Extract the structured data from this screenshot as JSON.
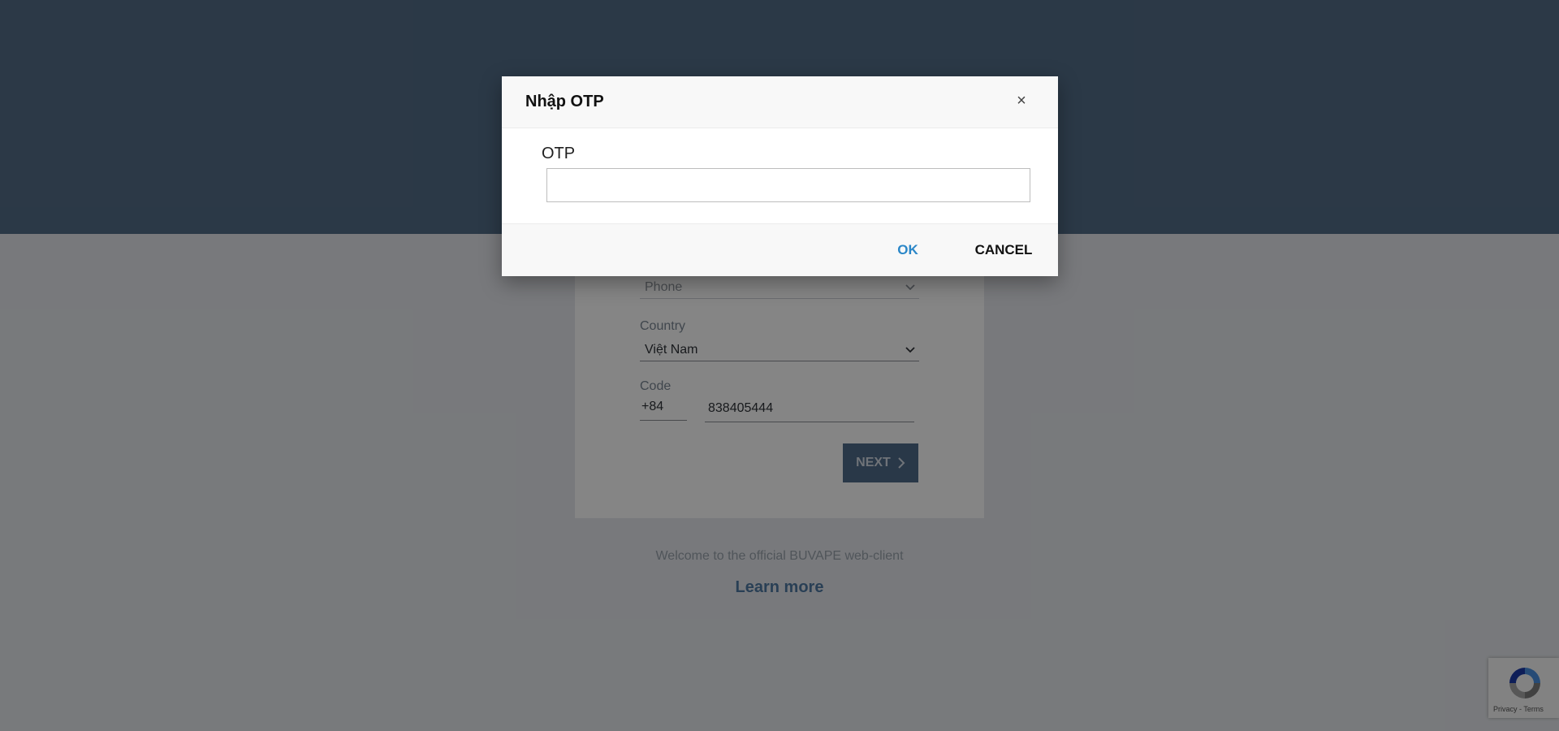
{
  "background": {
    "form": {
      "phone_placeholder": "Phone",
      "country_label": "Country",
      "country_value": "Việt Nam",
      "code_label": "Code",
      "code_prefix": "+84",
      "phone_value": "838405444",
      "next_label": "NEXT"
    },
    "welcome_text": "Welcome to the official BUVAPE web-client",
    "learn_more": "Learn more"
  },
  "modal": {
    "title": "Nhập OTP",
    "close_icon": "close-icon",
    "field_label": "OTP",
    "field_value": "",
    "ok_label": "OK",
    "cancel_label": "CANCEL"
  },
  "recaptcha": {
    "privacy": "Privacy",
    "separator": " - ",
    "terms": "Terms"
  },
  "colors": {
    "header_band": "#546e89",
    "ok_accent": "#2b87c8",
    "next_button": "#4f6b8a"
  }
}
